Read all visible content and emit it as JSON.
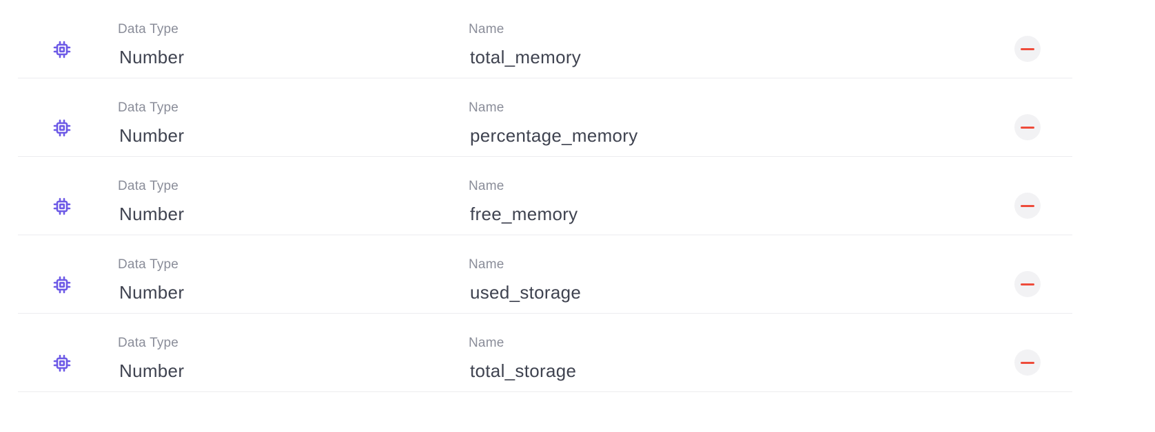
{
  "colors": {
    "icon_accent": "#6d5ae6",
    "remove_accent": "#ee4b3a",
    "label_text": "#8a8d99",
    "value_text": "#3f4350"
  },
  "icons": {
    "row_icon": "chip-icon",
    "remove_icon": "minus-icon"
  },
  "fields": [
    {
      "type_label": "Data Type",
      "type_value": "Number",
      "name_label": "Name",
      "name_value": "total_memory"
    },
    {
      "type_label": "Data Type",
      "type_value": "Number",
      "name_label": "Name",
      "name_value": "percentage_memory"
    },
    {
      "type_label": "Data Type",
      "type_value": "Number",
      "name_label": "Name",
      "name_value": "free_memory"
    },
    {
      "type_label": "Data Type",
      "type_value": "Number",
      "name_label": "Name",
      "name_value": "used_storage"
    },
    {
      "type_label": "Data Type",
      "type_value": "Number",
      "name_label": "Name",
      "name_value": "total_storage"
    }
  ]
}
